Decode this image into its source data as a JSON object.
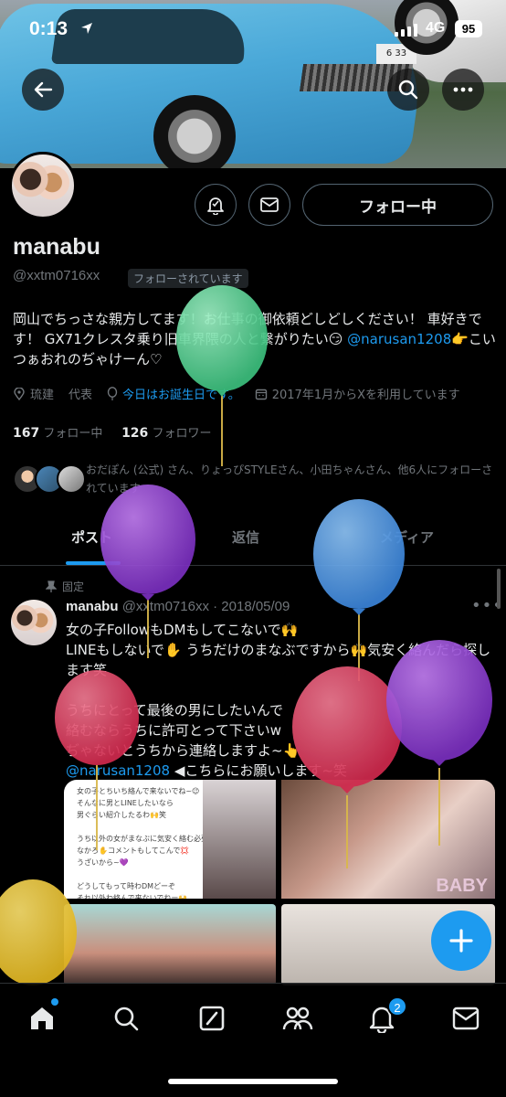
{
  "status_bar": {
    "time": "0:13",
    "network": "4G",
    "battery": "95"
  },
  "banner": {
    "plate_text": "6 33"
  },
  "profile": {
    "name": "manabu",
    "handle": "@xxtm0716xx",
    "follows_you": "フォローされています",
    "follow_button": "フォロー中",
    "bio_text": "岡山でちっさな親方してます！お仕事の御依頼どしどしください！ 車好きです！ GX71クレスタ乗り旧車界隈の人と繋がりたい😏 ",
    "bio_mention": "@narusan1208",
    "bio_tail": "👉こいつぁおれのぢゃけーん♡",
    "category": "琉建",
    "location": "代表",
    "birthday": "今日はお誕生日です。",
    "joined": "2017年1月からXを利用しています",
    "following_count": "167",
    "following_label": "フォロー中",
    "followers_count": "126",
    "followers_label": "フォロワー",
    "mutuals_text": "おだぽん (公式) さん、りょっぴSTYLEさん、小田ちゃんさん、他6人にフォローされています"
  },
  "tabs": [
    {
      "label": "ポスト"
    },
    {
      "label": "返信"
    },
    {
      "label": "メディア"
    }
  ],
  "tweet": {
    "pinned_label": "固定",
    "author": "manabu",
    "handle": "@xxtm0716xx",
    "date": "2018/05/09",
    "body": "女の子FollowもDMもしてこないで🙌\nLINEもしないで✋ うちだけのまなぶですから🙌気安く絡んだら探します笑\n\nうちにとって最後の男にしたいんで\n絡むならうちに許可とって下さいw\nぢゃないとうちから連絡しますよ~👆",
    "mention": "@narusan1208",
    "mention_tail": " ◀こちらにお願いします~笑",
    "image_note": "女の子とちいち絡んで来ないでね~😉\nそんなに男とLINEしたいなら\n男ぐらい紹介したるわ🙌笑\n\nうち以外の女がまなぶに気安く絡む必要\nなかろ✋コメントもしてこんで💢\nうざいから~💜\n\nどうしてもって時わDMどーぞ\nそれ以外わ絡んで来ないでねー🙌",
    "image_watermark": "BABY"
  },
  "bottom_nav": {
    "notifications_badge": "2"
  },
  "colors": {
    "accent": "#1d9bf0",
    "background": "#000000",
    "muted": "#71767b"
  },
  "icons": [
    "back-icon",
    "search-icon",
    "more-icon",
    "notification-bell-icon",
    "mail-icon",
    "location-icon",
    "balloon-icon",
    "calendar-icon",
    "pin-icon",
    "home-icon",
    "compose-icon",
    "communities-icon",
    "plus-icon"
  ]
}
